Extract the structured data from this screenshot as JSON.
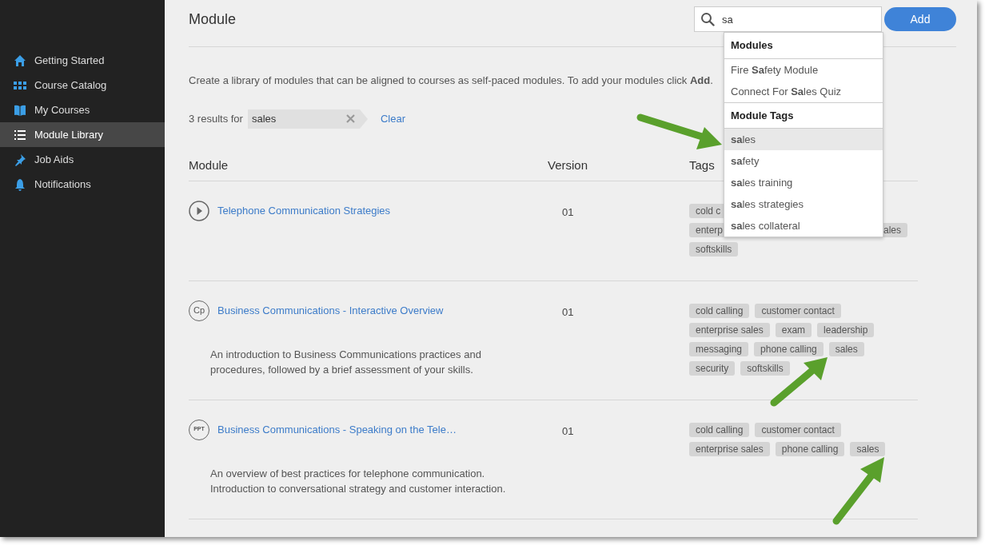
{
  "sidebar": {
    "items": [
      {
        "label": "Getting Started",
        "selected": false
      },
      {
        "label": "Course Catalog",
        "selected": false
      },
      {
        "label": "My Courses",
        "selected": false
      },
      {
        "label": "Module Library",
        "selected": true
      },
      {
        "label": "Job Aids",
        "selected": false
      },
      {
        "label": "Notifications",
        "selected": false
      }
    ]
  },
  "header": {
    "title": "Module",
    "search": {
      "value": "sa"
    },
    "add_button": "Add"
  },
  "description": "Create a library of modules that can be aligned to courses as self-paced modules. To add your modules click **Add**.",
  "filter": {
    "count_text": "3 results for",
    "tag": "sales",
    "clear": "Clear"
  },
  "table": {
    "columns": [
      "Module",
      "Version",
      "Tags"
    ],
    "rows": [
      {
        "icon": {
          "kind": "play"
        },
        "title": "Telephone Communication Strategies",
        "version": "01",
        "tag_lines": [
          [
            {
              "label": "cold c",
              "kind": "tag"
            }
          ],
          [
            {
              "label": "enterp",
              "kind": "tag"
            },
            {
              "label": "ales",
              "kind": "tail"
            }
          ],
          [
            {
              "label": "softskills",
              "kind": "tag"
            }
          ]
        ]
      },
      {
        "icon": {
          "kind": "badge",
          "text": "Cp"
        },
        "title": "Business Communications - Interactive Overview",
        "version": "01",
        "description": "An introduction to Business Communications practices and procedures, followed by a brief assessment of your skills.",
        "tag_lines": [
          [
            {
              "label": "cold calling",
              "kind": "tag"
            },
            {
              "label": "customer contact",
              "kind": "tag"
            }
          ],
          [
            {
              "label": "enterprise sales",
              "kind": "tag"
            },
            {
              "label": "exam",
              "kind": "tag"
            },
            {
              "label": "leadership",
              "kind": "tag"
            }
          ],
          [
            {
              "label": "messaging",
              "kind": "tag"
            },
            {
              "label": "phone calling",
              "kind": "tag"
            },
            {
              "label": "sales",
              "kind": "tag"
            }
          ],
          [
            {
              "label": "security",
              "kind": "tag"
            },
            {
              "label": "softskills",
              "kind": "tag"
            }
          ]
        ]
      },
      {
        "icon": {
          "kind": "badge",
          "text": "PPT"
        },
        "title": "Business Communications - Speaking on the Tele…",
        "version": "01",
        "description": "An overview of best practices for telephone communication. Introduction to conversational strategy and customer interaction.",
        "tag_lines": [
          [
            {
              "label": "cold calling",
              "kind": "tag"
            },
            {
              "label": "customer contact",
              "kind": "tag"
            }
          ],
          [
            {
              "label": "enterprise sales",
              "kind": "tag"
            },
            {
              "label": "phone calling",
              "kind": "tag"
            },
            {
              "label": "sales",
              "kind": "tag"
            }
          ]
        ]
      }
    ]
  },
  "dropdown": {
    "sections": [
      {
        "heading": "Modules",
        "items": [
          {
            "label": "Fire **Sa**fety Module",
            "selected": false
          },
          {
            "label": "Connect For **Sa**les Quiz",
            "selected": false
          }
        ]
      },
      {
        "heading": "Module Tags",
        "items": [
          {
            "label": "**sa**les",
            "selected": true
          },
          {
            "label": "**sa**fety",
            "selected": false
          },
          {
            "label": "**sa**les training",
            "selected": false
          },
          {
            "label": "**sa**les strategies",
            "selected": false
          },
          {
            "label": "**sa**les collateral",
            "selected": false
          }
        ]
      }
    ]
  }
}
